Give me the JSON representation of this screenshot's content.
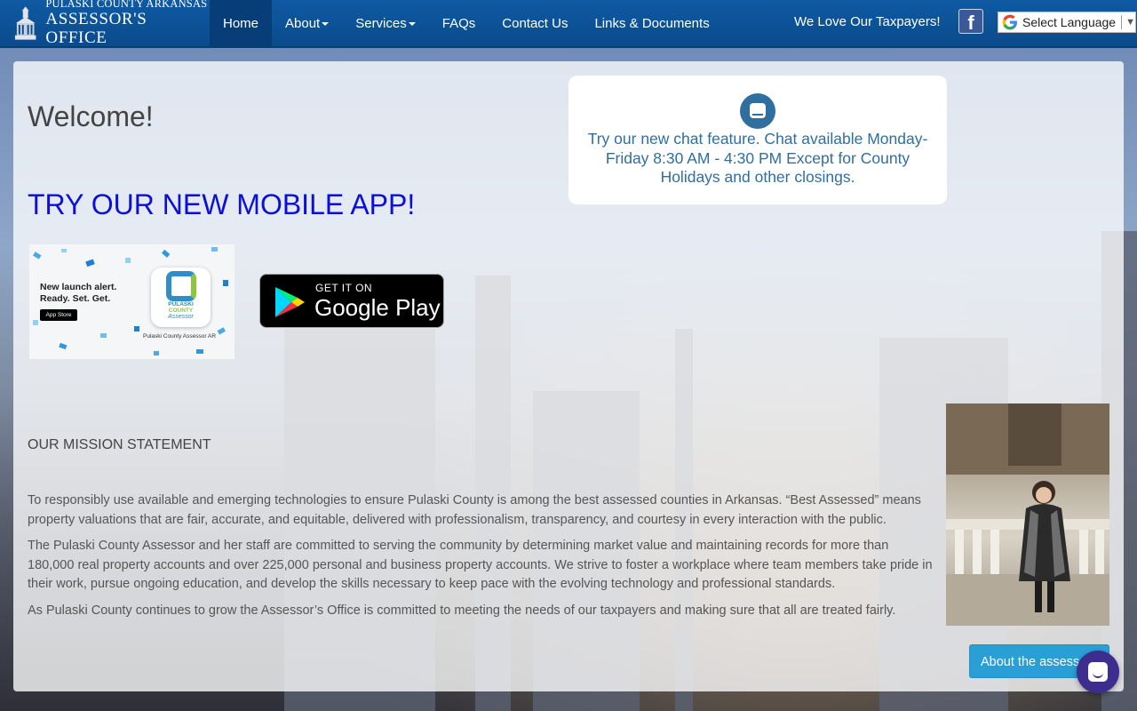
{
  "header": {
    "brand_line1": "PULASKI COUNTY ARKANSAS",
    "brand_line2": "ASSESSOR'S OFFICE",
    "nav": [
      {
        "label": "Home"
      },
      {
        "label": "About"
      },
      {
        "label": "Services"
      },
      {
        "label": "FAQs"
      },
      {
        "label": "Contact Us"
      },
      {
        "label": "Links & Documents"
      }
    ],
    "tagline": "We Love Our Taxpayers!",
    "facebook_icon": "f",
    "language_select": "Select Language"
  },
  "main": {
    "welcome": "Welcome!",
    "app_heading": "TRY OUR NEW MOBILE APP!",
    "app_store_promo": {
      "line1": "New launch alert.",
      "line2": "Ready. Set. Get.",
      "store_badge": "App Store",
      "app_logo_text_1": "PULASKI",
      "app_logo_text_2": "COUNTY",
      "app_logo_text_3": "Assessor",
      "app_name": "Pulaski County Assessor AR"
    },
    "google_play": {
      "small": "GET IT ON",
      "big": "Google Play"
    },
    "chat": {
      "text": "Try our new chat feature. Chat available Monday-Friday 8:30 AM - 4:30 PM Except for County Holidays and other closings."
    },
    "mission_title": "OUR MISSION STATEMENT",
    "mission_paragraphs": [
      "To responsibly use available and emerging technologies to ensure Pulaski County is among the best assessed counties in Arkansas. “Best Assessed” means property valuations that are fair, accurate, and equitable, delivered with professionalism, transparency, and courtesy in every interaction with the public.",
      "The Pulaski County Assessor and her staff are committed to serving the community by determining market value and maintaining records for more than 180,000 real property accounts and over 225,000 personal and business property accounts. We strive to foster a workplace where team members take pride in their work, pursue ongoing education, and develop the skills necessary to keep pace with the evolving technology and professional standards.",
      "As Pulaski County continues to grow the Assessor’s Office is committed to meeting the needs of our taxpayers and making sure that all are treated fairly."
    ],
    "about_button": "About the assessor"
  },
  "colors": {
    "nav_bg": "#0a4b8c",
    "app_heading": "#0a10d6",
    "chat_text": "#2f6fa0",
    "button": "#2a9fd6",
    "chat_launcher": "#3d2d8f"
  }
}
